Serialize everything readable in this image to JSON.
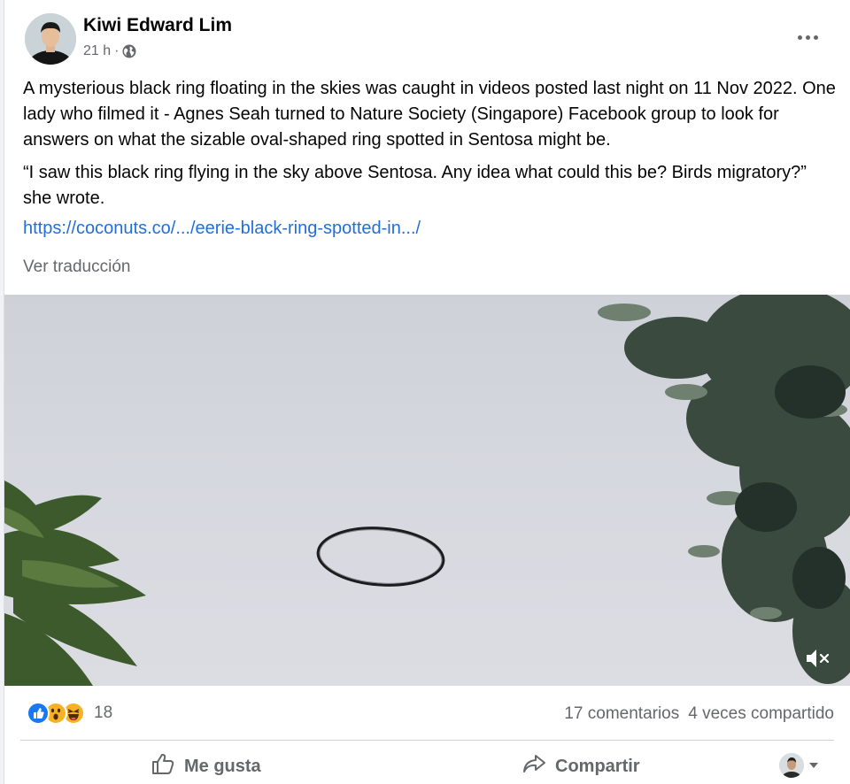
{
  "post": {
    "author": "Kiwi Edward Lim",
    "time": "21 h",
    "separator": "·",
    "paragraphs": [
      "A mysterious black ring floating in the skies was caught in videos posted last night on 11 Nov 2022. One lady who filmed it - Agnes Seah turned to Nature Society (Singapore) Facebook group to look for answers on what the sizable oval-shaped ring spotted in Sentosa might be.",
      "“I saw this black ring flying in the sky above Sentosa. Any idea what could this be? Birds migratory?” she wrote."
    ],
    "link": "https://coconuts.co/.../eerie-black-ring-spotted-in.../",
    "translate": "Ver traducción"
  },
  "icons": {
    "avatar": "avatar",
    "privacy": "globe-icon",
    "more": "more-options-icon",
    "mute": "muted-speaker-icon",
    "like": "thumbs-up-icon",
    "share": "share-arrow-icon",
    "reactions": [
      "like-reaction-icon",
      "wow-reaction-icon",
      "haha-reaction-icon"
    ]
  },
  "reactions": {
    "count": "18"
  },
  "stats": {
    "comments": "17 comentarios",
    "shares": "4 veces compartido"
  },
  "actions": {
    "like": "Me gusta",
    "share": "Compartir"
  },
  "colors": {
    "link": "#216fdb",
    "secondary_text": "#65676b",
    "like_blue": "#1877f2",
    "reaction_yellow": "#f7b125"
  }
}
